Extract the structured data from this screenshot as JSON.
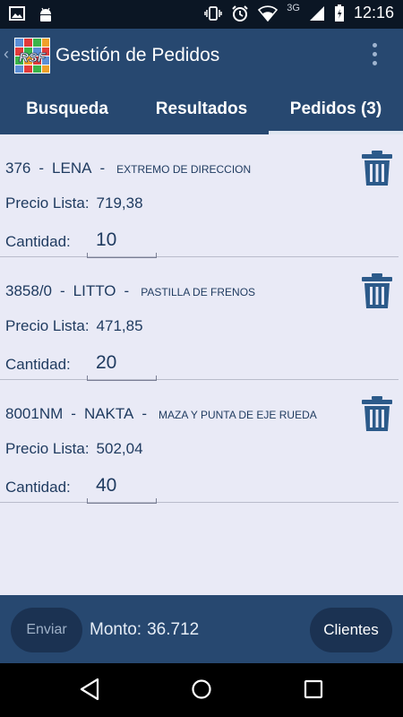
{
  "status_bar": {
    "time": "12:16",
    "network": "3G"
  },
  "app_bar": {
    "title": "Gestión de Pedidos",
    "logo_text": "RSF"
  },
  "tabs": [
    {
      "label": "Busqueda"
    },
    {
      "label": "Resultados"
    },
    {
      "label": "Pedidos (3)"
    }
  ],
  "labels": {
    "price": "Precio Lista:",
    "quantity": "Cantidad:",
    "separator": "-"
  },
  "orders": [
    {
      "code": "376",
      "brand": "LENA",
      "description": "EXTREMO DE DIRECCION",
      "price": "719,38",
      "quantity": "10"
    },
    {
      "code": "3858/0",
      "brand": "LITTO",
      "description": "PASTILLA DE FRENOS",
      "price": "471,85",
      "quantity": "20"
    },
    {
      "code": "8001NM",
      "brand": "NAKTA",
      "description": "MAZA Y PUNTA DE EJE RUEDA",
      "price": "502,04",
      "quantity": "40"
    }
  ],
  "bottom_bar": {
    "send_label": "Enviar",
    "total_label": "Monto:",
    "total_value": "36.712",
    "clients_label": "Clientes"
  },
  "colors": {
    "primary": "#274870",
    "background": "#e9eaf6",
    "text": "#1e3a5f",
    "trash": "#2c5a8a"
  },
  "icons": [
    "image-icon",
    "android-icon",
    "vibrate-icon",
    "alarm-icon",
    "wifi-icon",
    "signal-icon",
    "battery-icon",
    "overflow-menu-icon",
    "trash-icon",
    "back-nav-icon",
    "home-nav-icon",
    "recents-nav-icon"
  ]
}
